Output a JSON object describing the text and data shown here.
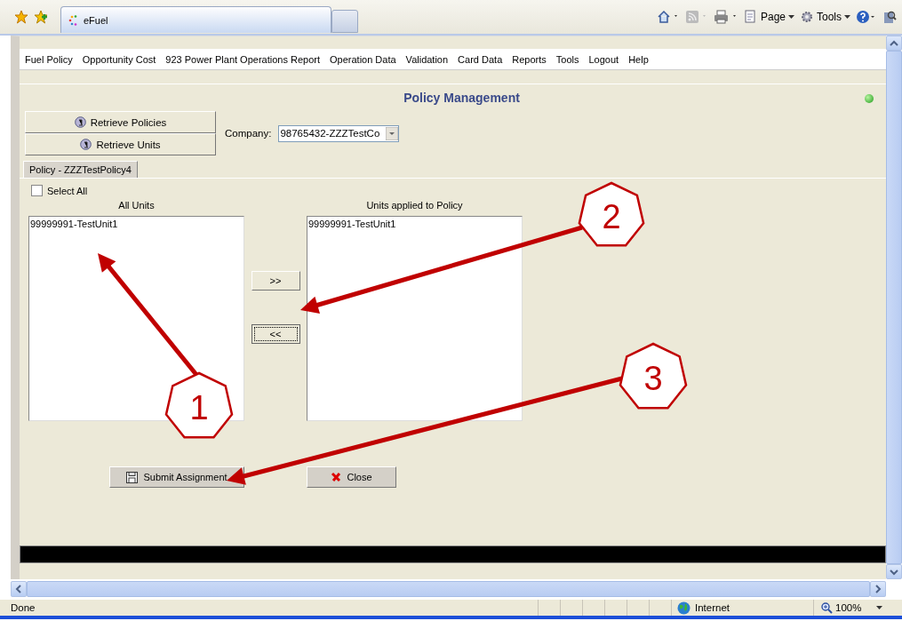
{
  "browser": {
    "tab_title": "eFuel",
    "toolbar": [
      {
        "kind": "page",
        "label": "Page"
      },
      {
        "kind": "tools",
        "label": "Tools"
      }
    ]
  },
  "menu": [
    "Fuel Policy",
    "Opportunity Cost",
    "923 Power Plant Operations Report",
    "Operation Data",
    "Validation",
    "Card Data",
    "Reports",
    "Tools",
    "Logout",
    "Help"
  ],
  "page": {
    "title": "Policy Management"
  },
  "retrieve_buttons": [
    "Retrieve Policies",
    "Retrieve Units"
  ],
  "company": {
    "label": "Company:",
    "value": "98765432-ZZZTestCo"
  },
  "tabs": [
    {
      "label": "Policy - ZZZTestPolicy4",
      "selected": true
    }
  ],
  "select_all": {
    "label": "Select All",
    "checked": false
  },
  "all_units": {
    "title": "All Units",
    "items": [
      "99999991-TestUnit1"
    ]
  },
  "applied_units": {
    "title": "Units applied to Policy",
    "items": [
      "99999991-TestUnit1"
    ]
  },
  "move_buttons": [
    {
      "label": ">>",
      "focused": false
    },
    {
      "label": "<<",
      "focused": true
    }
  ],
  "actions": [
    {
      "kind": "submit",
      "label": "Submit Assignment"
    },
    {
      "kind": "close",
      "label": "Close"
    }
  ],
  "annotations": [
    {
      "number": "1"
    },
    {
      "number": "2"
    },
    {
      "number": "3"
    }
  ],
  "status_bar": {
    "text": "Done",
    "zone": "Internet",
    "zoom": "100%"
  }
}
